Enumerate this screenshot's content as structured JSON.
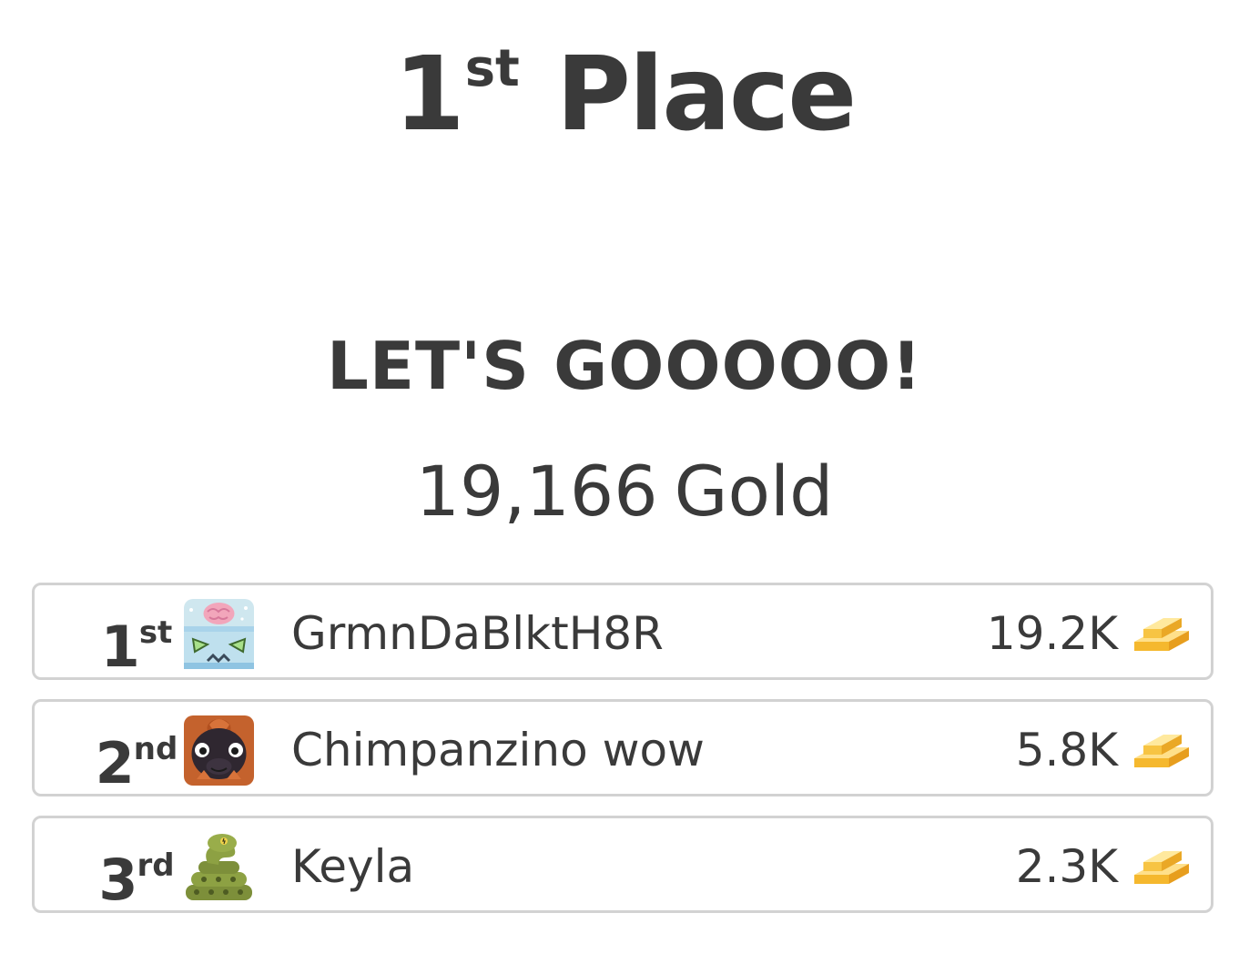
{
  "header": {
    "place_number": "1",
    "place_suffix": "st",
    "place_word": "Place"
  },
  "hype_text": "LET'S GOOOOO!",
  "gold_total": {
    "amount": "19,166",
    "unit": "Gold"
  },
  "leaderboard": [
    {
      "rank_number": "1",
      "rank_suffix": "st",
      "name": "GrmnDaBlktH8R",
      "score": "19.2K",
      "avatar_icon": "brain-robot-avatar-icon",
      "currency_icon": "gold-bars-icon"
    },
    {
      "rank_number": "2",
      "rank_suffix": "nd",
      "name": "Chimpanzino wow",
      "score": "5.8K",
      "avatar_icon": "monkey-avatar-icon",
      "currency_icon": "gold-bars-icon"
    },
    {
      "rank_number": "3",
      "rank_suffix": "rd",
      "name": "Keyla",
      "score": "2.3K",
      "avatar_icon": "snake-avatar-icon",
      "currency_icon": "gold-bars-icon"
    }
  ],
  "colors": {
    "text": "#3a3a3a",
    "row_border": "#d2d2d2",
    "gold": "#f5c242"
  }
}
